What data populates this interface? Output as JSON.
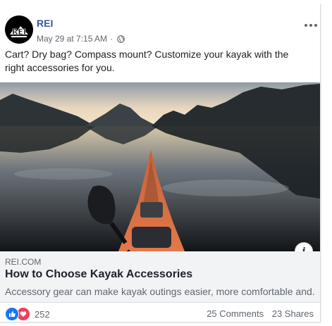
{
  "post": {
    "page_name": "REI",
    "logo_text": "REI",
    "timestamp": "May 29 at 7:15 AM",
    "separator": "·",
    "text": "Cart? Dry bag? Compass mount? Customize your kayak with the right accessories for you."
  },
  "link": {
    "domain": "REI.COM",
    "title": "How to Choose Kayak Accessories",
    "description": "Accessory gear can make kayak outings easier, more comfortable and..."
  },
  "footer": {
    "reaction_count": "252",
    "comments": "25 Comments",
    "shares": "23 Shares"
  },
  "icons": [
    "globe-icon",
    "more-options-icon",
    "info-icon",
    "like-reaction-icon",
    "love-reaction-icon"
  ],
  "colors": {
    "page_name": "#365899",
    "like": "#1877f2",
    "love": "#f33e58"
  }
}
